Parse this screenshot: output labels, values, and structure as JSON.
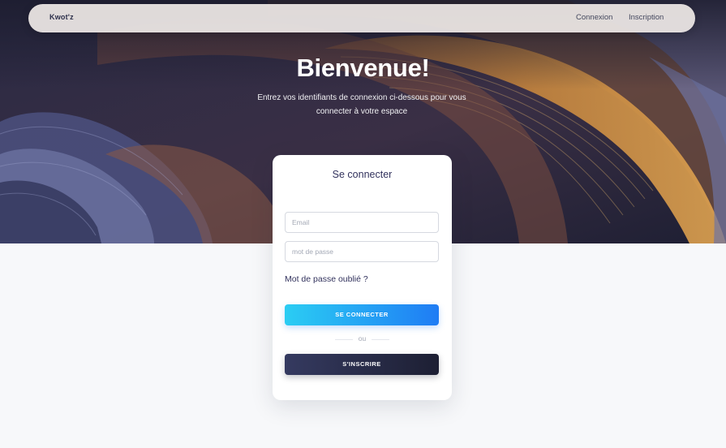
{
  "navbar": {
    "brand": "Kwot'z",
    "links": [
      {
        "label": "Connexion"
      },
      {
        "label": "Inscription"
      }
    ]
  },
  "hero": {
    "title": "Bienvenue!",
    "subtitle": "Entrez vos identifiants de connexion ci-dessous pour vous connecter à votre espace"
  },
  "login_card": {
    "title": "Se connecter",
    "email": {
      "value": "",
      "placeholder": "Email"
    },
    "password": {
      "value": "",
      "placeholder": "mot de passe"
    },
    "forgot_password": "Mot de passe oublié ?",
    "login_button": "SE CONNECTER",
    "separator": "ou",
    "signup_button": "S'INSCRIRE"
  },
  "colors": {
    "primary_gradient": [
      "#2bcdf3",
      "#1f7cf4"
    ],
    "dark_gradient": [
      "#353a60",
      "#1d1f33"
    ],
    "text_dark": "#32325d",
    "page_background": "#f7f8fa"
  }
}
